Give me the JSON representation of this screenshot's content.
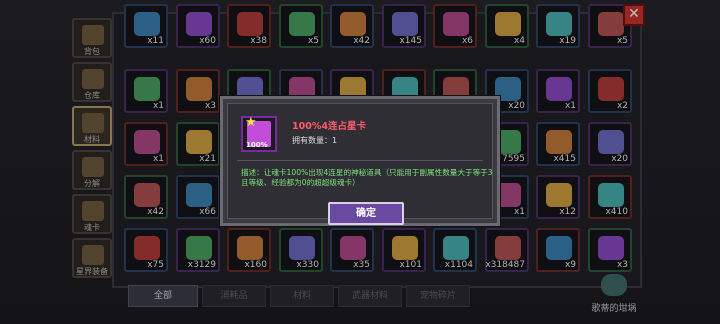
{
  "sidebar": {
    "tabs": [
      {
        "label": "背包"
      },
      {
        "label": "仓库"
      },
      {
        "label": "材料"
      },
      {
        "label": "分解"
      },
      {
        "label": "魂卡"
      },
      {
        "label": "星界装备"
      }
    ]
  },
  "close_label": "✕",
  "grid_counts": [
    [
      "x11",
      "x60",
      "x38",
      "x5",
      "x42",
      "x145",
      "x6",
      "x4",
      "x19",
      "x5"
    ],
    [
      "x1",
      "x3",
      "",
      "",
      "",
      "",
      "",
      "x20",
      "x1",
      "x2"
    ],
    [
      "x1",
      "x21",
      "",
      "",
      "",
      "",
      "",
      "7595",
      "x415",
      "x20"
    ],
    [
      "x42",
      "x66",
      "",
      "",
      "",
      "",
      "",
      "x1",
      "x12",
      "x410"
    ],
    [
      "x75",
      "x3129",
      "x160",
      "x330",
      "x35",
      "x101",
      "x1104",
      "x318487",
      "x9",
      "x3"
    ]
  ],
  "bottom_tabs": [
    "全部",
    "消耗品",
    "材料",
    "武器材料",
    "宠物碎片"
  ],
  "shop_label": "歌蒂的坩埚",
  "dialog": {
    "item_pct": "100%",
    "item_name": "100%4连占星卡",
    "owned": "拥有数量：1",
    "desc": "描述：让魂卡100%出现4连星的神秘道具（只能用于副属性数量大于等于3且等级、经验都为0的超超级魂卡）",
    "ok": "确定"
  },
  "colors": {
    "accent": "#6a4aa0",
    "item_name": "#ff5b6a",
    "desc": "#7fe07a",
    "close": "#c8352e"
  }
}
